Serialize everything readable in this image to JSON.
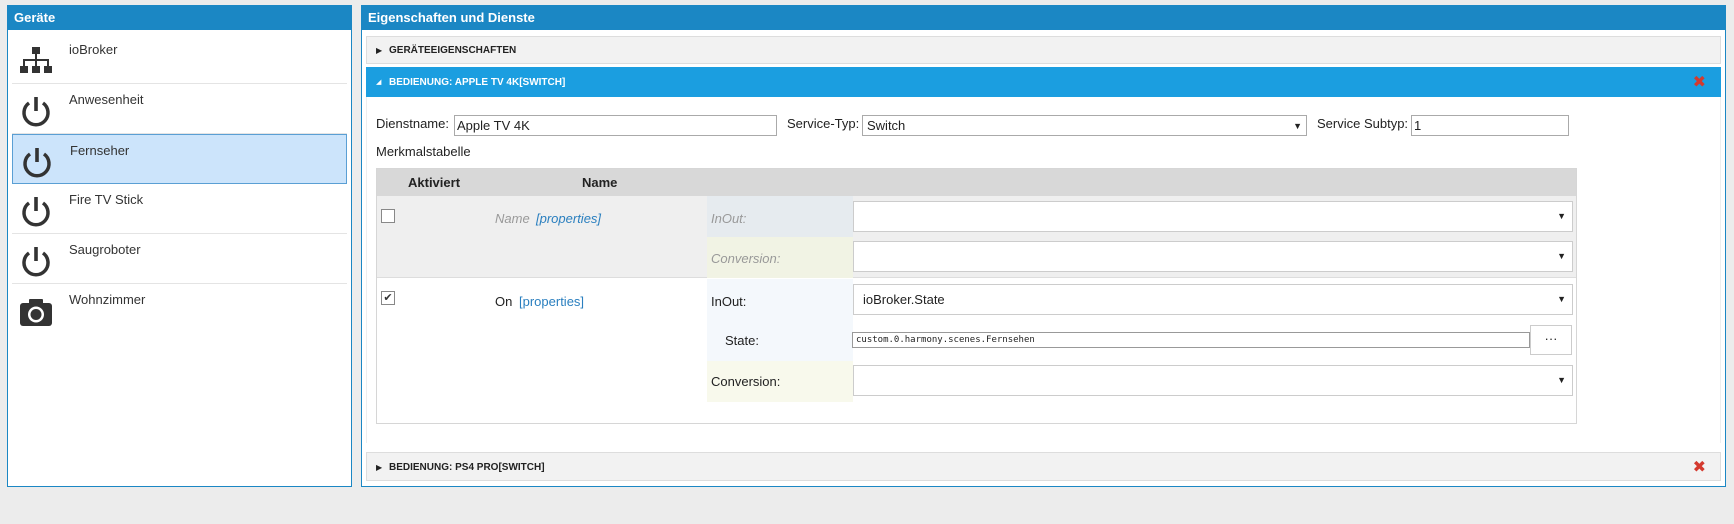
{
  "left_panel": {
    "title": "Geräte",
    "devices": [
      {
        "label": "ioBroker",
        "icon": "network-tree-icon"
      },
      {
        "label": "Anwesenheit",
        "icon": "power-icon"
      },
      {
        "label": "Fernseher",
        "icon": "power-icon",
        "selected": true
      },
      {
        "label": "Fire TV Stick",
        "icon": "power-icon"
      },
      {
        "label": "Saugroboter",
        "icon": "power-icon"
      },
      {
        "label": "Wohnzimmer",
        "icon": "camera-icon"
      }
    ]
  },
  "right_panel": {
    "title": "Eigenschaften und Dienste",
    "sections": {
      "device_props": "GERÄTEEIGENSCHAFTEN",
      "active_service": "BEDIENUNG: APPLE TV 4K[SWITCH]",
      "other_service": "BEDIENUNG: PS4 PRO[SWITCH]"
    },
    "service": {
      "name_label": "Dienstname:",
      "name_value": "Apple TV 4K",
      "type_label": "Service-Typ:",
      "type_value": "Switch",
      "subtype_label": "Service Subtyp:",
      "subtype_value": "1"
    },
    "table": {
      "caption": "Merkmalstabelle",
      "col_active": "Aktiviert",
      "col_name": "Name",
      "rows": [
        {
          "checked": false,
          "name": "Name",
          "link": "[properties]",
          "inout_label": "InOut:",
          "inout_value": "",
          "conversion_label": "Conversion:",
          "conversion_value": ""
        },
        {
          "checked": true,
          "name": "On",
          "link": "[properties]",
          "inout_label": "InOut:",
          "inout_value": "ioBroker.State",
          "state_label": "State:",
          "state_value": "custom.0.harmony.scenes.Fernsehen",
          "state_button": "···",
          "conversion_label": "Conversion:",
          "conversion_value": ""
        }
      ]
    }
  },
  "colors": {
    "header_blue": "#1b87c4",
    "active_section": "#1b9ee0",
    "delete_red": "#d43a2f",
    "selected_bg": "#cce4fb"
  }
}
